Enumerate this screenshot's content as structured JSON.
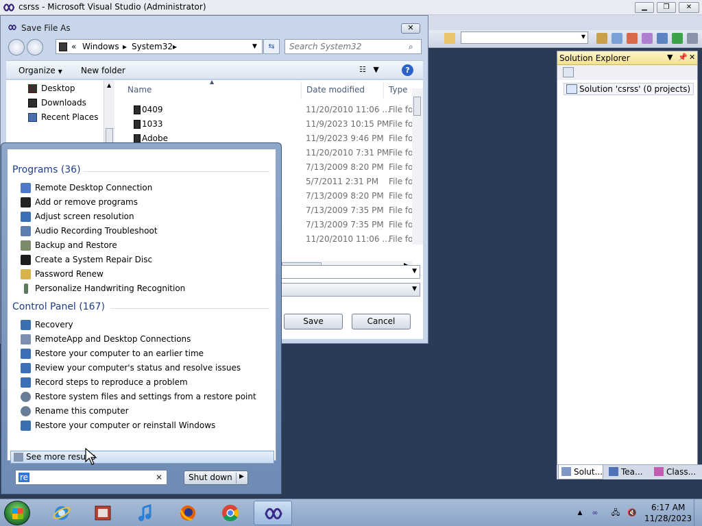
{
  "vs": {
    "title": "csrss - Microsoft Visual Studio (Administrator)",
    "solution_explorer": {
      "title": "Solution Explorer",
      "node": "Solution 'csrss' (0 projects)",
      "tabs": [
        "Solut...",
        "Tea...",
        "Class..."
      ]
    }
  },
  "save_dialog": {
    "title": "Save File As",
    "breadcrumb": [
      "«",
      "Windows",
      "System32"
    ],
    "search_placeholder": "Search System32",
    "organize": "Organize",
    "new_folder": "New folder",
    "nav_items": [
      "Desktop",
      "Downloads",
      "Recent Places"
    ],
    "columns": [
      "Name",
      "Date modified",
      "Type"
    ],
    "files": [
      {
        "name": "0409",
        "date": "11/20/2010 11:06 ...",
        "type": "File fol"
      },
      {
        "name": "1033",
        "date": "11/9/2023 10:15 PM",
        "type": "File fol"
      },
      {
        "name": "Adobe",
        "date": "11/9/2023 9:46 PM",
        "type": "File fol"
      },
      {
        "name": "",
        "date": "11/20/2010 7:31 PM",
        "type": "File fol"
      },
      {
        "name": "",
        "date": "7/13/2009 8:20 PM",
        "type": "File fol"
      },
      {
        "name": "",
        "date": "5/7/2011 2:31 PM",
        "type": "File fol"
      },
      {
        "name": "",
        "date": "7/13/2009 8:20 PM",
        "type": "File fol"
      },
      {
        "name": "",
        "date": "7/13/2009 7:35 PM",
        "type": "File fol"
      },
      {
        "name": "",
        "date": "7/13/2009 7:35 PM",
        "type": "File fol"
      },
      {
        "name": "",
        "date": "11/20/2010 11:06 ...",
        "type": "File fol"
      }
    ],
    "save_label": "Save",
    "cancel_label": "Cancel"
  },
  "start_menu": {
    "programs_header": "Programs (36)",
    "programs": [
      "Remote Desktop Connection",
      "Add or remove programs",
      "Adjust screen resolution",
      "Audio Recording Troubleshoot",
      "Backup and Restore",
      "Create a System Repair Disc",
      "Password Renew",
      "Personalize Handwriting Recognition"
    ],
    "control_panel_header": "Control Panel (167)",
    "control_panel": [
      "Recovery",
      "RemoteApp and Desktop Connections",
      "Restore your computer to an earlier time",
      "Review your computer's status and resolve issues",
      "Record steps to reproduce a problem",
      "Restore system files and settings from a restore point",
      "Rename this computer",
      "Restore your computer or reinstall Windows"
    ],
    "see_more": "See more results",
    "search_value": "re",
    "shutdown_label": "Shut down"
  },
  "taskbar": {
    "apps": [
      "internet-explorer",
      "media-center",
      "itunes",
      "firefox",
      "chrome",
      "visual-studio"
    ],
    "clock_time": "6:17 AM",
    "clock_date": "11/28/2023"
  }
}
